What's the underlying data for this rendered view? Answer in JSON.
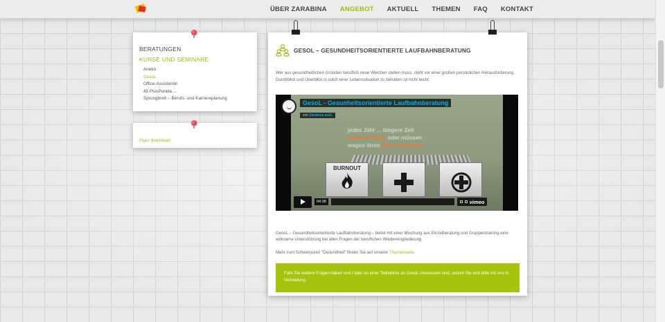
{
  "nav": {
    "items": [
      {
        "label": "ÜBER ZARABINA"
      },
      {
        "label": "ANGEBOT"
      },
      {
        "label": "AKTUELL"
      },
      {
        "label": "THEMEN"
      },
      {
        "label": "FAQ"
      },
      {
        "label": "KONTAKT"
      }
    ],
    "active": "ANGEBOT"
  },
  "sidebar": {
    "heading": "BERATUNGEN",
    "subheading": "KURSE UND SEMINARE",
    "items": [
      {
        "label": "Aneko"
      },
      {
        "label": "GesoL"
      },
      {
        "label": "Office-Assistentin"
      },
      {
        "label": "45 PlusPunkte…"
      },
      {
        "label": "Sprungbrett – Berufs- und Karriereplanung"
      }
    ],
    "active_item": "GesoL"
  },
  "flyer": {
    "label": "Flyer download"
  },
  "main": {
    "icon": "people-group-icon",
    "title": "GESOL – GESUNDHEITSORIENTIERTE LAUFBAHNBERATUNG",
    "intro": "Wer aus gesundheitlichen Gründen beruflich neue Weichen stellen muss, steht vor einer großen persönlichen Herausforderung. Durchblick und Überblick in solch einer Lebenssituation zu behalten ist nicht leicht.",
    "video": {
      "title": "GesoL - Gesunheitsorientierte Laufbahnberatung",
      "by_prefix": "von",
      "by_author": "Zarabina asbl.",
      "overlay_line1": "jedes Jahr ... längere Zeit",
      "overlay_line2": "arbeitsunfähig",
      "overlay_line2b": "oder müssen",
      "overlay_line3": "wagen ihren",
      "overlay_line3b": "Beruf wechseln",
      "box1_label": "BURNOUT",
      "duration": "04:38",
      "brand": "vimeo"
    },
    "description": "GesoL – Gesundheitsorientierte Laufbahnberatung – bietet mit einer Mischung aus Einzelberatung und Gruppentraining eine wirksame Unterstützung bei allen Fragen der beruflichen Wiedereingliederung.",
    "more_prefix": "Mehr zum Schwerpunkt \"Gesundheit\" finden Sie auf unserer",
    "more_link": "Themenseite",
    "more_suffix": ".",
    "cta": "Falls Sie weitere Fragen haben und / oder an einer Teilnahme an GesoL interessiert sind, setzen Sie sich bitte mit uns in Verbindung."
  },
  "colors": {
    "accent": "#9dbd0c",
    "cta_bg": "#a6c40d",
    "video_title": "#00adef"
  }
}
